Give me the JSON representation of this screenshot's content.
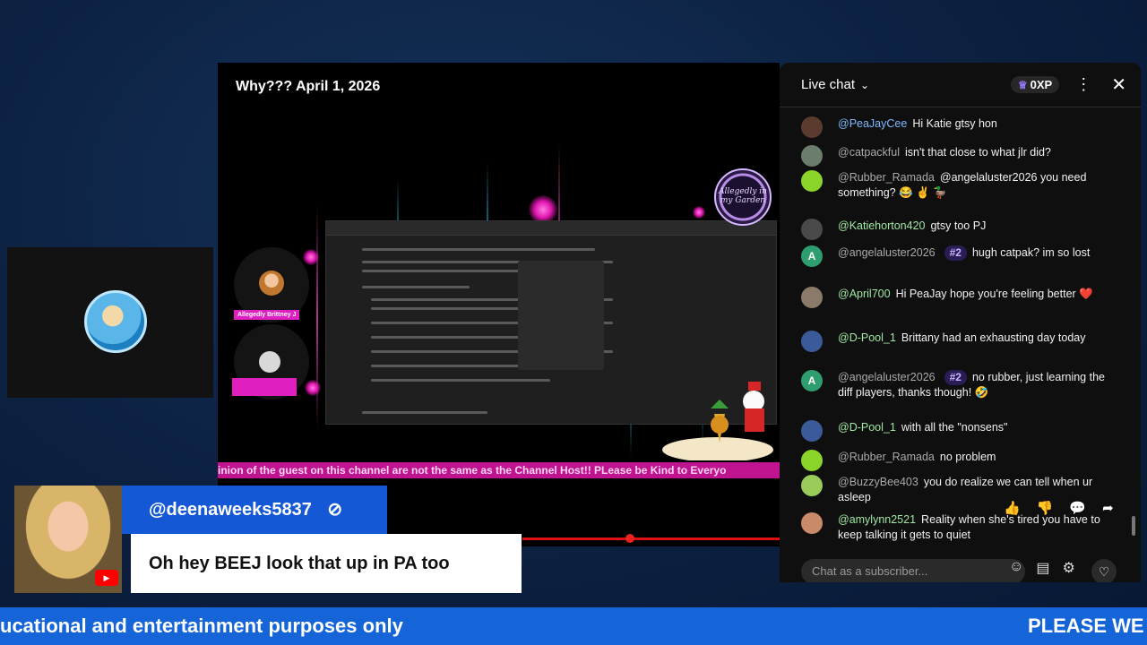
{
  "video": {
    "title": "Why??? April 1, 2026",
    "ticker": "inion of the guest on this channel are not the same as the Channel Host!! PLease be Kind to Everyo",
    "logo_text": "Allegedly in my Garden"
  },
  "chat": {
    "title": "Live chat",
    "xp": "0XP",
    "input_placeholder": "Chat as a subscriber...",
    "messages": [
      {
        "author": "@PeaJayCee",
        "text": "Hi Katie gtsy hon",
        "avatar_color": "#5a3b2e"
      },
      {
        "author": "@catpackful",
        "text": "isn't that close to what jlr did?",
        "avatar_color": "#6b7d6b"
      },
      {
        "author": "@Rubber_Ramada",
        "text": "@angelaluster2026 you need something? 😂 ✌️ 🦆",
        "avatar_color": "#8bd42a"
      },
      {
        "author": "@Katiehorton420",
        "text": "gtsy too PJ",
        "avatar_color": "#4a4a4a"
      },
      {
        "author": "@angelaluster2026",
        "rank": "#2",
        "text": "hugh catpak? im so lost",
        "avatar_letter": "A",
        "avatar_color": "#2e9e6e"
      },
      {
        "author": "@April700",
        "text": "Hi PeaJay hope you're feeling better ❤️",
        "avatar_color": "#8a7a6a"
      },
      {
        "author": "@D-Pool_1",
        "text": "Brittany had an exhausting day today",
        "avatar_color": "#3a5a9a"
      },
      {
        "author": "@angelaluster2026",
        "rank": "#2",
        "text": "no rubber, just learning the diff players, thanks though! 🤣",
        "avatar_letter": "A",
        "avatar_color": "#2e9e6e"
      },
      {
        "author": "@D-Pool_1",
        "text": "with all the \"nonsens\"",
        "avatar_color": "#3a5a9a"
      },
      {
        "author": "@Rubber_Ramada",
        "text": "no problem",
        "avatar_color": "#8bd42a"
      },
      {
        "author": "@BuzzyBee403",
        "text": "you do realize we can tell when ur asleep",
        "avatar_color": "#9acb5a"
      },
      {
        "author": "@amylynn2521",
        "text": "Reality when she's tired you have to keep talking it gets to quiet",
        "avatar_color": "#c98a6a"
      }
    ]
  },
  "lower_third": {
    "handle": "@deenaweeks5837",
    "comment": "Oh hey BEEJ look that up in PA too"
  },
  "ticker": {
    "left": "ucational and entertainment purposes only",
    "right": "PLEASE WE"
  },
  "colors": {
    "accent_blue": "#1565d8",
    "ticker_pink": "#c0138f",
    "progress_red": "#dd1111"
  }
}
